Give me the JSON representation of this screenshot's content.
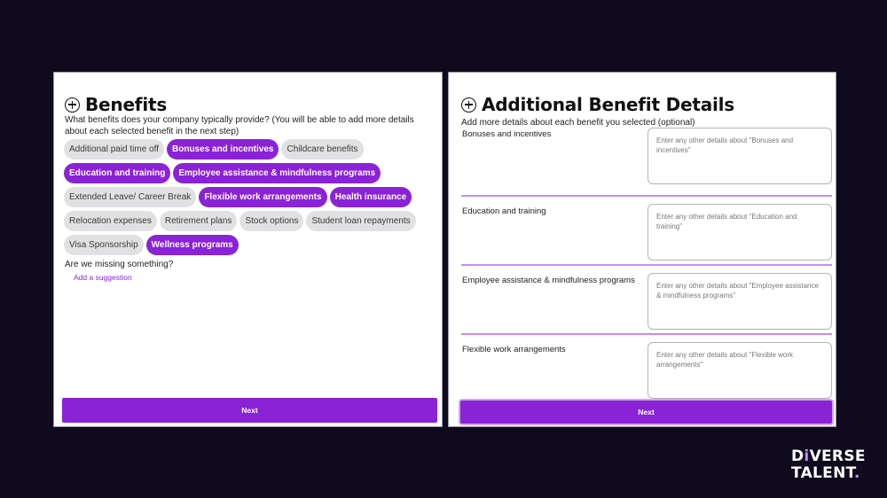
{
  "benefits_panel": {
    "title": "Benefits",
    "icon": "plus-circle-icon",
    "subtitle": "What benefits does your company typically provide? (You will be able to add more details about each selected benefit in the next step)",
    "chips": [
      {
        "label": "Additional paid time off",
        "selected": false
      },
      {
        "label": "Bonuses and incentives",
        "selected": true
      },
      {
        "label": "Childcare benefits",
        "selected": false
      },
      {
        "label": "Education and training",
        "selected": true
      },
      {
        "label": "Employee assistance & mindfulness programs",
        "selected": true
      },
      {
        "label": "Extended Leave/ Career Break",
        "selected": false
      },
      {
        "label": "Flexible work arrangements",
        "selected": true
      },
      {
        "label": "Health insurance",
        "selected": true
      },
      {
        "label": "Relocation expenses",
        "selected": false
      },
      {
        "label": "Retirement plans",
        "selected": false
      },
      {
        "label": "Stock options",
        "selected": false
      },
      {
        "label": "Student loan repayments",
        "selected": false
      },
      {
        "label": "Visa Sponsorship",
        "selected": false
      },
      {
        "label": "Wellness programs",
        "selected": true
      }
    ],
    "missing_text": "Are we missing something?",
    "suggestion_link": "Add a suggestion",
    "next_label": "Next"
  },
  "details_panel": {
    "title": "Additional Benefit Details",
    "icon": "plus-circle-icon",
    "subtitle": "Add more details about each benefit you selected (optional)",
    "rows": [
      {
        "label": "Bonuses and incentives",
        "value": "",
        "placeholder": "Enter any other details about \"Bonuses and incentives\""
      },
      {
        "label": "Education and training",
        "value": "",
        "placeholder": "Enter any other details about \"Education and training\""
      },
      {
        "label": "Employee assistance & mindfulness programs",
        "value": "",
        "placeholder": "Enter any other details about \"Employee assistance & mindfulness programs\""
      },
      {
        "label": "Flexible work arrangements",
        "value": "",
        "placeholder": "Enter any other details about \"Flexible work arrangements\""
      }
    ],
    "next_label": "Next"
  },
  "brand": {
    "line1_prefix": "D",
    "line1_i": "i",
    "line1_suffix": "VERSE",
    "line2": "TALENT",
    "line2_dot": ".",
    "accent_color": "#c58cf5"
  },
  "colors": {
    "primary": "#8a22d6",
    "chip_unselected": "#e1e1e3",
    "divider": "#c98cf0",
    "background": "#0f0a1e"
  }
}
